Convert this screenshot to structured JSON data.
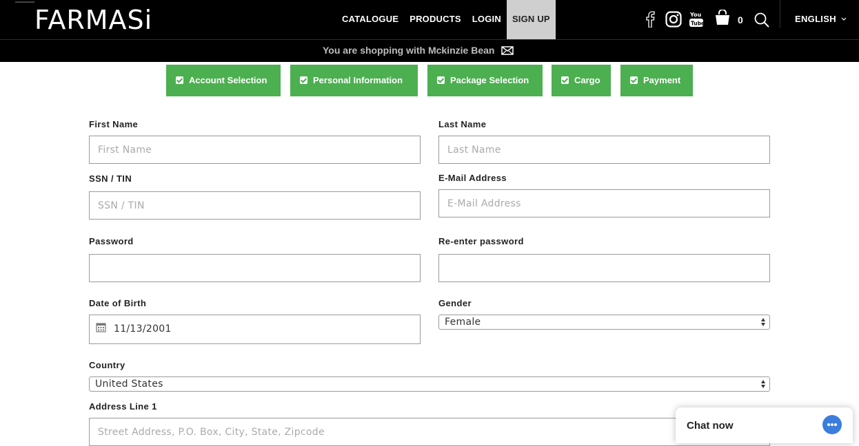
{
  "header": {
    "logo": "FARMASi",
    "nav": [
      "CATALOGUE",
      "PRODUCTS",
      "LOGIN",
      "SIGN UP"
    ],
    "active_nav": "SIGN UP",
    "cart_count": "0",
    "language": "ENGLISH",
    "icons": [
      "facebook-icon",
      "instagram-icon",
      "youtube-icon",
      "cart-icon",
      "search-icon",
      "chevron-down-icon"
    ]
  },
  "subbar": {
    "text": "You are shopping with Mckinzie Bean",
    "icon": "envelope-icon"
  },
  "steps": [
    {
      "label": "Account Selection"
    },
    {
      "label": "Personal Information"
    },
    {
      "label": "Package Selection"
    },
    {
      "label": "Cargo"
    },
    {
      "label": "Payment"
    }
  ],
  "form": {
    "first_name": {
      "label": "First Name",
      "placeholder": "First Name",
      "value": ""
    },
    "last_name": {
      "label": "Last Name",
      "placeholder": "Last Name",
      "value": ""
    },
    "ssn": {
      "label": "SSN / TIN",
      "placeholder": "SSN / TIN",
      "value": ""
    },
    "email": {
      "label": "E-Mail Address",
      "placeholder": "E-Mail Address",
      "value": ""
    },
    "password": {
      "label": "Password",
      "value": ""
    },
    "reenter_password": {
      "label": "Re-enter password",
      "value": ""
    },
    "dob": {
      "label": "Date of Birth",
      "value": "11/13/2001"
    },
    "gender": {
      "label": "Gender",
      "value": "Female"
    },
    "country": {
      "label": "Country",
      "value": "United States"
    },
    "address1": {
      "label": "Address Line 1",
      "placeholder": "Street Address, P.O. Box, City, State, Zipcode",
      "value": ""
    }
  },
  "chat": {
    "label": "Chat now"
  },
  "colors": {
    "header_bg": "#000000",
    "step_green": "#4caf50",
    "chat_blue": "#3b7ddd",
    "active_nav_bg": "#cfcfcf"
  }
}
